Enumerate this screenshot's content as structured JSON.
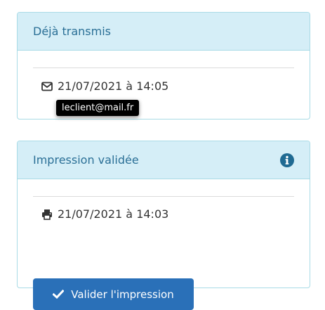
{
  "transmitted_panel": {
    "title": "Déjà transmis",
    "date_label": "21/07/2021 à 14:05",
    "email_icon": "envelope-icon",
    "tooltip": "leclient@mail.fr"
  },
  "print_panel": {
    "title": "Impression validée",
    "info_icon": "info-circle-icon",
    "date_label": "21/07/2021 à 14:03",
    "print_icon": "printer-icon",
    "validate_button_label": "Valider l'impression",
    "validate_button_icon": "check-icon"
  },
  "colors": {
    "heading_bg": "#d5eef7",
    "heading_text": "#2a6f96",
    "border": "#a9dbe6",
    "button_bg": "#2a70b8",
    "tooltip_bg": "#000000"
  }
}
